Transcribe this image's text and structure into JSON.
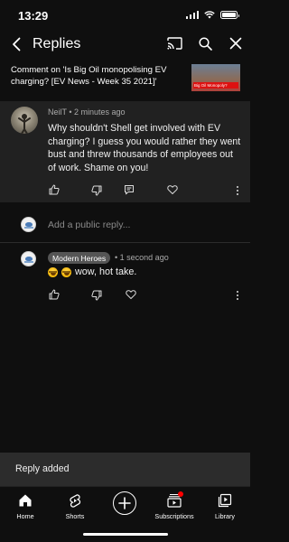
{
  "status_bar": {
    "time": "13:29"
  },
  "header": {
    "title": "Replies"
  },
  "video_reference": {
    "text": "Comment on 'Is Big Oil monopolising EV charging? [EV News - Week 35 2021]'",
    "thumbnail_caption": "Big Oil Monopoly?"
  },
  "parent_comment": {
    "author": "NeilT",
    "time": "2 minutes ago",
    "text": "Why shouldn't Shell get involved with EV charging? I guess you would rather they went bust and threw thousands of employees out of work. Shame on you!"
  },
  "reply_input": {
    "placeholder": "Add a public reply..."
  },
  "reply": {
    "author": "Modern Heroes",
    "time": "1 second ago",
    "text": "wow, hot take."
  },
  "toast": {
    "text": "Reply added"
  },
  "bottom_nav": {
    "items": [
      {
        "label": "Home",
        "icon": "home-icon"
      },
      {
        "label": "Shorts",
        "icon": "shorts-icon"
      },
      {
        "label": "",
        "icon": "create-icon"
      },
      {
        "label": "Subscriptions",
        "icon": "subscriptions-icon"
      },
      {
        "label": "Library",
        "icon": "library-icon"
      }
    ]
  },
  "colors": {
    "background": "#0f0f0f",
    "highlight_comment": "#212121",
    "toast": "#2c2c2c",
    "notification_dot": "#ff0000"
  }
}
